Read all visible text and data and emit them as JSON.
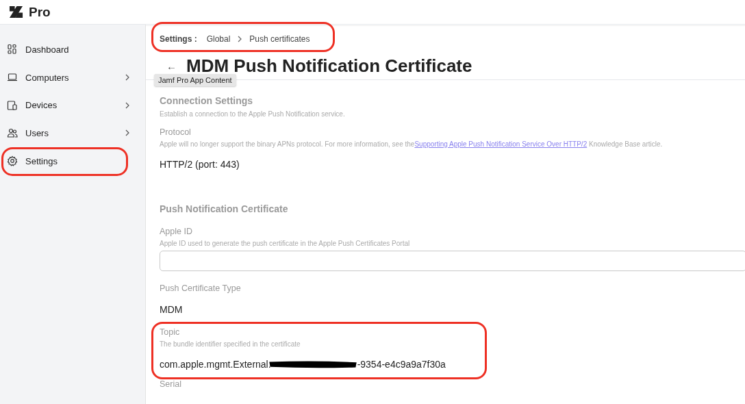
{
  "header": {
    "product": "Pro"
  },
  "sidebar": {
    "items": [
      {
        "label": "Dashboard",
        "chevron": false,
        "highlighted": false
      },
      {
        "label": "Computers",
        "chevron": true,
        "highlighted": false
      },
      {
        "label": "Devices",
        "chevron": true,
        "highlighted": false
      },
      {
        "label": "Users",
        "chevron": true,
        "highlighted": false
      },
      {
        "label": "Settings",
        "chevron": false,
        "highlighted": true
      }
    ]
  },
  "breadcrumb": {
    "root": "Settings :",
    "items": [
      "Global",
      "Push certificates"
    ],
    "highlighted": true
  },
  "page": {
    "back": "←",
    "title": "MDM Push Notification Certificate",
    "tooltip": "Jamf Pro App Content"
  },
  "sections": [
    {
      "title": "Connection Settings",
      "description": "Establish a connection to the Apple Push Notification service.",
      "fields": [
        {
          "kind": "text",
          "label": "Protocol",
          "help": "Apple will no longer support the binary APNs protocol. For more information, see the",
          "link": "Supporting Apple Push Notification Service Over HTTP/2",
          "help_after": "Knowledge Base article.",
          "value": "HTTP/2 (port: 443)"
        }
      ]
    },
    {
      "title": "Push Notification Certificate",
      "fields": [
        {
          "kind": "input",
          "label": "Apple ID",
          "help": "Apple ID used to generate the push certificate in the Apple Push Certificates Portal"
        },
        {
          "kind": "text",
          "label": "Push Certificate Type",
          "value": "MDM"
        },
        {
          "kind": "redacted",
          "label": "Topic",
          "help": "The bundle identifier specified in the certificate",
          "value": "com.apple.mgmt.External.",
          "value_end": "-9354-e4c9a9a7f30a",
          "highlighted": true
        }
      ],
      "cut_label": "Serial"
    }
  ]
}
